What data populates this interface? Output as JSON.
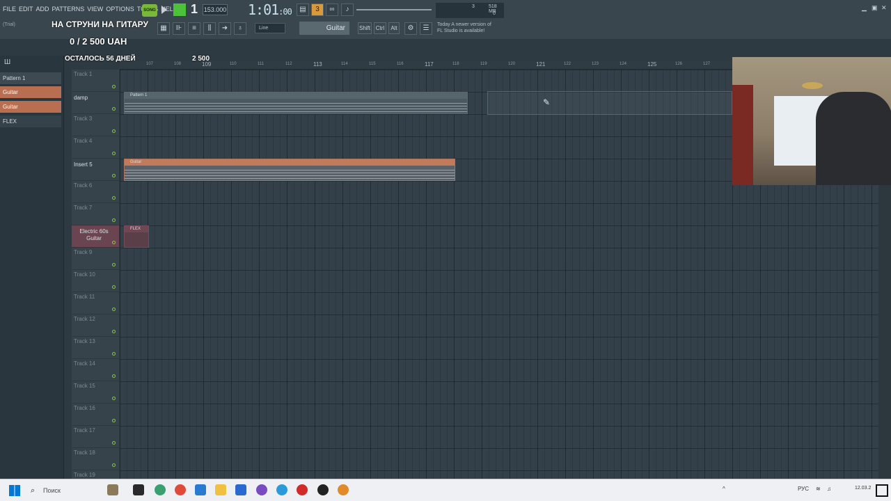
{
  "menu": [
    "FILE",
    "EDIT",
    "ADD",
    "PATTERNS",
    "VIEW",
    "OPTIONS",
    "TOOLS",
    "HELP"
  ],
  "transport": {
    "song_label": "SONG",
    "pattern_number": "1",
    "tempo": "153.000",
    "time_main": "1:01",
    "time_sub": ":00",
    "cpu_value": "3",
    "memory": "518 MB",
    "poly": "0"
  },
  "trial_label": "(Trial)",
  "overlay": {
    "title": "НА СТРУНИ НА ГИТАРУ",
    "amount": "0 / 2 500 UAH",
    "days": "ОСТАЛОСЬ 56 ДНЕЙ",
    "goal": "2 500"
  },
  "toolbar2": {
    "snap_mode": "Line",
    "selected_pattern": "Guitar",
    "shift_label": "Shift",
    "ctrl_label": "Ctrl",
    "alt_label": "Alt"
  },
  "news": {
    "label": "Today",
    "line1": "A newer version of",
    "line2": "FL Studio is available!"
  },
  "channels": [
    {
      "label": "Pattern 1",
      "style": "gray"
    },
    {
      "label": "Guitar",
      "style": "orange"
    },
    {
      "label": "Guitar",
      "style": "orange"
    },
    {
      "label": "FLEX",
      "style": "plain"
    }
  ],
  "tracks": [
    {
      "label": "Track 1",
      "active": false
    },
    {
      "label": "damp",
      "active": true
    },
    {
      "label": "Track 3",
      "active": false
    },
    {
      "label": "Track 4",
      "active": false
    },
    {
      "label": "Insert 5",
      "active": true
    },
    {
      "label": "Track 6",
      "active": false
    },
    {
      "label": "Track 7",
      "active": false
    },
    {
      "label": "Electric 60s Guitar",
      "active": true
    },
    {
      "label": "Track 9",
      "active": false
    },
    {
      "label": "Track 10",
      "active": false
    },
    {
      "label": "Track 11",
      "active": false
    },
    {
      "label": "Track 12",
      "active": false
    },
    {
      "label": "Track 13",
      "active": false
    },
    {
      "label": "Track 14",
      "active": false
    },
    {
      "label": "Track 15",
      "active": false
    },
    {
      "label": "Track 16",
      "active": false
    },
    {
      "label": "Track 17",
      "active": false
    },
    {
      "label": "Track 18",
      "active": false
    },
    {
      "label": "Track 19",
      "active": false
    }
  ],
  "ruler_ticks": [
    "107",
    "108",
    "109",
    "110",
    "111",
    "112",
    "113",
    "114",
    "115",
    "116",
    "117",
    "118",
    "119",
    "120",
    "121",
    "122",
    "123",
    "124",
    "125",
    "126",
    "127"
  ],
  "clips": [
    {
      "title": "Pattern 1"
    },
    {
      "title": "Guitar"
    },
    {
      "title": "FLEX"
    }
  ],
  "taskbar": {
    "search_placeholder": "Поиск",
    "lang": "РУС",
    "date": "12.03.2"
  },
  "colors": {
    "accent_green": "#4cc23a",
    "clip_orange": "#c07a5c",
    "background": "#344049"
  }
}
